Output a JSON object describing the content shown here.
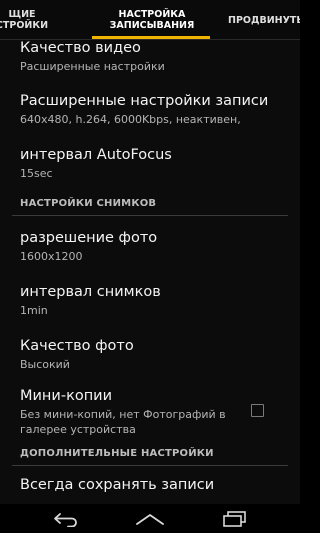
{
  "tabs": [
    {
      "label": "ЩИЕ\nСТРОЙКИ"
    },
    {
      "label": "НАСТРОЙКА\nЗАПИСЫВАНИЯ"
    },
    {
      "label": "ПРОДВИНУТЫ"
    }
  ],
  "settings": {
    "video_quality": {
      "title": "Качество видео",
      "summary": "Расширенные настройки"
    },
    "advanced_record": {
      "title": "Расширенные настройки записи",
      "summary": "640x480, h.264, 6000Kbps, неактивен,"
    },
    "autofocus": {
      "title": "интервал AutoFocus",
      "summary": "15sec"
    }
  },
  "sections": {
    "photo": "НАСТРОЙКИ СНИМКОВ",
    "extra": "ДОПОЛНИТЕЛЬНЫЕ НАСТРОЙКИ"
  },
  "photo_settings": {
    "resolution": {
      "title": "разрешение фото",
      "summary": "1600x1200"
    },
    "interval": {
      "title": "интервал снимков",
      "summary": "1min"
    },
    "quality": {
      "title": "Качество фото",
      "summary": "Высокий"
    },
    "thumbnails": {
      "title": "Мини-копии",
      "summary": "Без мини-копий, нет Фотографий в галерее устройства",
      "checked": false
    }
  },
  "extra_settings": {
    "always_save": {
      "title": "Всегда сохранять записи"
    }
  },
  "navbar": {
    "icons": [
      "back-icon",
      "home-icon",
      "recent-apps-icon"
    ]
  },
  "colors": {
    "accent": "#f0b400"
  }
}
